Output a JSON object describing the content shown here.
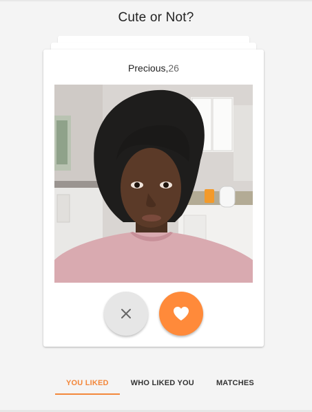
{
  "header": {
    "title": "Cute or Not?"
  },
  "profile": {
    "name": "Precious,",
    "age": "26"
  },
  "actions": {
    "nope_icon": "close-icon",
    "like_icon": "heart-icon"
  },
  "tabs": [
    {
      "label": "YOU LIKED",
      "active": true
    },
    {
      "label": "WHO LIKED YOU",
      "active": false
    },
    {
      "label": "MATCHES",
      "active": false
    }
  ],
  "colors": {
    "accent": "#ff8a3a",
    "tab_active": "#f3873a",
    "background": "#f4f4f4",
    "card": "#ffffff",
    "nope_button": "#e6e6e6"
  }
}
